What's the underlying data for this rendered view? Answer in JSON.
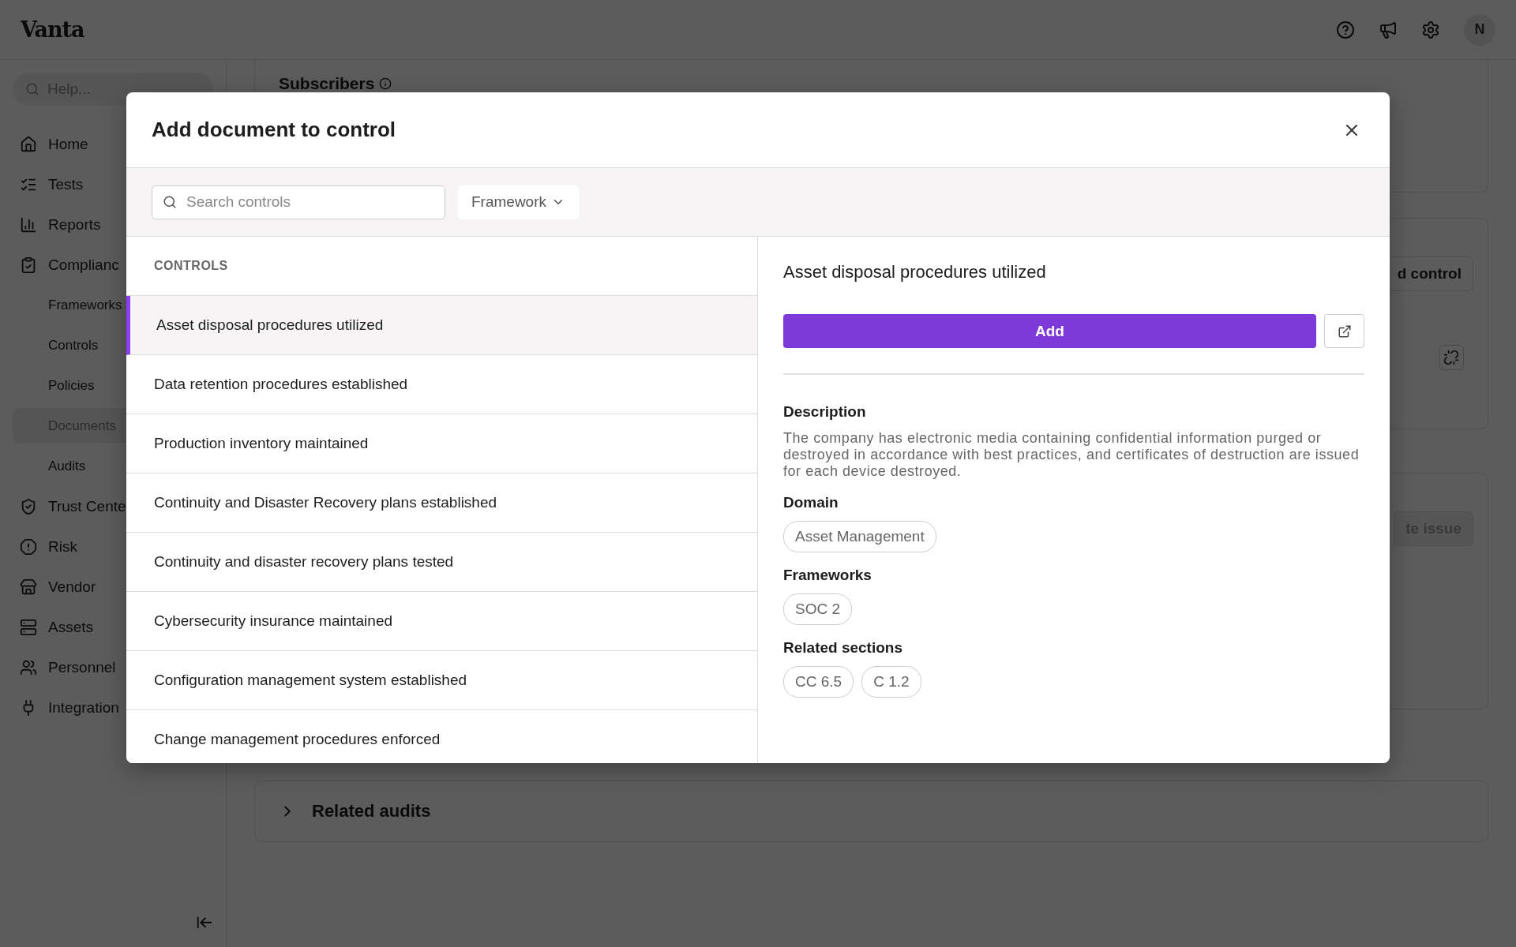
{
  "topbar": {
    "logo": "Vanta",
    "avatar": "N"
  },
  "sidebar": {
    "search_placeholder": "Help...",
    "items": [
      {
        "label": "Home",
        "selected": false
      },
      {
        "label": "Tests",
        "selected": false
      },
      {
        "label": "Reports",
        "selected": false
      },
      {
        "label": "Complianc",
        "selected": false,
        "children": [
          {
            "label": "Frameworks",
            "selected": false
          },
          {
            "label": "Controls",
            "selected": false
          },
          {
            "label": "Policies",
            "selected": false
          },
          {
            "label": "Documents",
            "selected": true
          },
          {
            "label": "Audits",
            "selected": false
          }
        ]
      },
      {
        "label": "Trust Cente",
        "selected": false
      },
      {
        "label": "Risk",
        "selected": false
      },
      {
        "label": "Vendor",
        "selected": false
      },
      {
        "label": "Assets",
        "selected": false
      },
      {
        "label": "Personnel",
        "selected": false
      },
      {
        "label": "Integration",
        "selected": false
      }
    ]
  },
  "background": {
    "subscribers_title": "Subscribers",
    "control_button": "d control",
    "issue_button": "te issue",
    "related_audits": "Related audits"
  },
  "modal": {
    "title": "Add document to control",
    "search_placeholder": "Search controls",
    "filter": "Framework",
    "list_heading": "CONTROLS",
    "controls": [
      {
        "label": "Asset disposal procedures utilized",
        "selected": true
      },
      {
        "label": "Data retention procedures established",
        "selected": false
      },
      {
        "label": "Production inventory maintained",
        "selected": false
      },
      {
        "label": "Continuity and Disaster Recovery plans established",
        "selected": false
      },
      {
        "label": "Continuity and disaster recovery plans tested",
        "selected": false
      },
      {
        "label": "Cybersecurity insurance maintained",
        "selected": false
      },
      {
        "label": "Configuration management system established",
        "selected": false
      },
      {
        "label": "Change management procedures enforced",
        "selected": false
      }
    ],
    "detail": {
      "title": "Asset disposal procedures utilized",
      "add_button": "Add",
      "sections": [
        {
          "kind": "text",
          "label": "Description",
          "text": "The company has electronic media containing confidential information purged or destroyed in accordance with best practices, and certificates of destruction are issued for each device destroyed."
        },
        {
          "kind": "tags",
          "label": "Domain",
          "tags": [
            "Asset Management"
          ]
        },
        {
          "kind": "tags",
          "label": "Frameworks",
          "tags": [
            "SOC 2"
          ]
        },
        {
          "kind": "tags",
          "label": "Related sections",
          "tags": [
            "CC 6.5",
            "C 1.2"
          ]
        }
      ]
    }
  }
}
